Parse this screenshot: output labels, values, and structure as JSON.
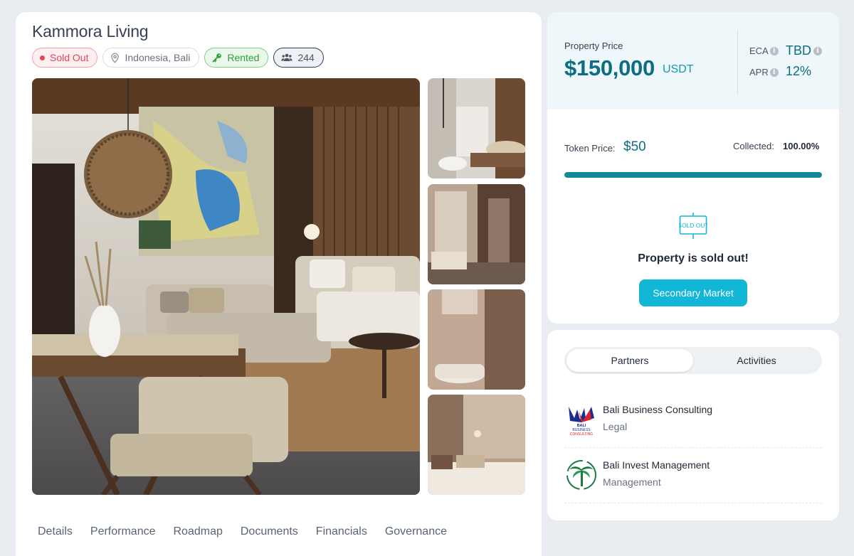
{
  "property": {
    "title": "Kammora Living",
    "badges": {
      "status": "Sold Out",
      "location": "Indonesia, Bali",
      "rental": "Rented",
      "holders": "244"
    }
  },
  "tabs": [
    "Details",
    "Performance",
    "Roadmap",
    "Documents",
    "Financials",
    "Governance"
  ],
  "price_card": {
    "property_price_label": "Property Price",
    "property_price_value": "$150,000",
    "property_price_unit": "USDT",
    "eca_label": "ECA",
    "eca_value": "TBD",
    "apr_label": "APR",
    "apr_value": "12%",
    "token_price_label": "Token Price:",
    "token_price_value": "$50",
    "collected_label": "Collected:",
    "collected_value": "100.00%",
    "collected_fraction": 1.0,
    "sold_out_icon_text": "SOLD OUT",
    "sold_out_message": "Property is sold out!",
    "secondary_button": "Secondary Market"
  },
  "partners_card": {
    "tabs": [
      "Partners",
      "Activities"
    ],
    "active_tab": "Partners",
    "partners": [
      {
        "name": "Bali Business Consulting",
        "role": "Legal",
        "logo_text": "BALI BUSINESS CONSULTING"
      },
      {
        "name": "Bali Invest Management",
        "role": "Management"
      }
    ]
  },
  "colors": {
    "accent": "#12b6d6",
    "price_text": "#0f6d82",
    "progress": "#118a96",
    "sold_out": "#e0475b",
    "rented": "#2f9e3b"
  },
  "icons": [
    "location-pin-icon",
    "key-icon",
    "users-icon",
    "info-icon",
    "sold-out-sign-icon"
  ]
}
